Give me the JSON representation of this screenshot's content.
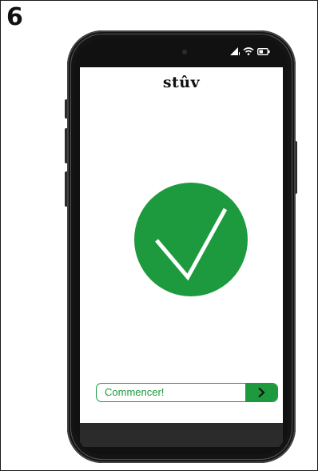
{
  "step": {
    "number": "6"
  },
  "app": {
    "brand": "stûv"
  },
  "status": {
    "icons": [
      "signal-icon",
      "wifi-icon",
      "battery-icon"
    ]
  },
  "success": {
    "icon": "checkmark-icon",
    "color": "#1d9a3e"
  },
  "cta": {
    "label": "Commencer!",
    "icon": "chevron-right-icon",
    "color": "#1d9a3e"
  }
}
